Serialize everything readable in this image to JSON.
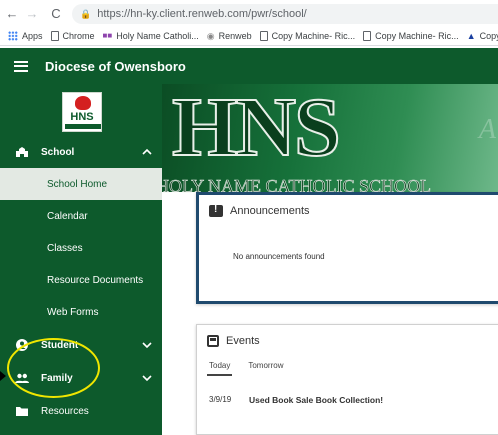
{
  "browser": {
    "back_glyph": "←",
    "forward_glyph": "→",
    "reload_glyph": "C",
    "url": "https://hn-ky.client.renweb.com/pwr/school/",
    "bookmarks": [
      {
        "label": "Apps",
        "icon": "apps-grid-icon"
      },
      {
        "label": "Chrome",
        "icon": "document-icon"
      },
      {
        "label": "Holy Name Catholi...",
        "icon": "renweb-icon"
      },
      {
        "label": "Renweb",
        "icon": "eye-icon"
      },
      {
        "label": "Copy Machine- Ric...",
        "icon": "document-icon"
      },
      {
        "label": "Copy Machine- Ric...",
        "icon": "document-icon"
      },
      {
        "label": "Copy Ma",
        "icon": "car-icon"
      }
    ]
  },
  "header": {
    "title": "Diocese of Owensboro"
  },
  "colors": {
    "brand_green": "#0d5a2c",
    "active_item_bg": "#e3e9e3",
    "highlight_annotation": "#f0e600",
    "card_focus_border": "#1f4a6e"
  },
  "sidebar": {
    "logo_text": "HNS",
    "school": {
      "label": "School",
      "icon": "school-building-icon",
      "expanded": true
    },
    "school_items": [
      {
        "label": "School Home",
        "active": true
      },
      {
        "label": "Calendar"
      },
      {
        "label": "Classes"
      },
      {
        "label": "Resource Documents"
      },
      {
        "label": "Web Forms"
      }
    ],
    "student": {
      "label": "Student",
      "icon": "person-icon"
    },
    "family": {
      "label": "Family",
      "icon": "group-icon"
    },
    "resources": {
      "label": "Resources",
      "icon": "folder-icon"
    }
  },
  "banner": {
    "letters": "HNS",
    "school_name": "HOLY NAME CATHOLIC SCHOOL",
    "script_fragment": "A"
  },
  "announcements": {
    "title": "Announcements",
    "empty_message": "No announcements found"
  },
  "events": {
    "title": "Events",
    "tabs": [
      "Today",
      "Tomorrow"
    ],
    "items": [
      {
        "date": "3/9/19",
        "title": "Used Book Sale Book Collection!"
      }
    ]
  }
}
